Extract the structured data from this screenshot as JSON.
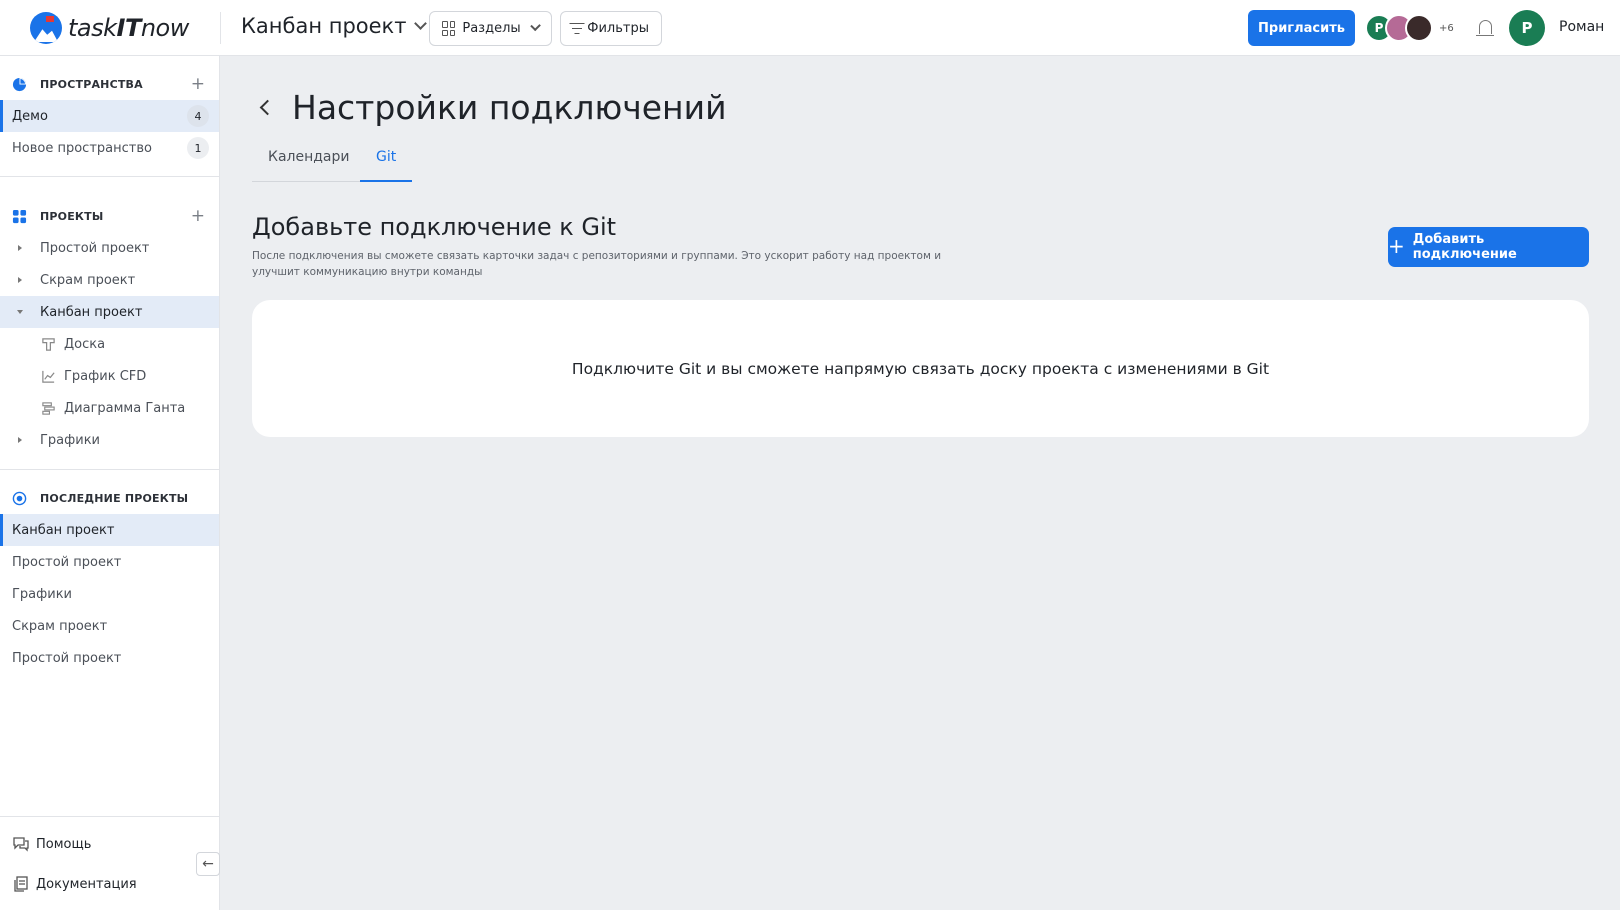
{
  "header": {
    "logo_text_1": "task",
    "logo_text_2": "IT",
    "logo_text_3": "now",
    "project_title": "Канбан проект",
    "sections_label": "Разделы",
    "filters_label": "Фильтры",
    "invite_label": "Пригласить",
    "avatars": [
      {
        "initial": "Р",
        "color": "#1a7d54"
      },
      {
        "initial": "",
        "color": "#b56a96"
      },
      {
        "initial": "",
        "color": "#3a2a2a"
      }
    ],
    "more_count": "+6",
    "user_initial": "Р",
    "user_name": "Роман"
  },
  "sidebar": {
    "spaces_title": "ПРОСТРАНСТВА",
    "spaces": [
      {
        "label": "Демо",
        "count": "4"
      },
      {
        "label": "Новое пространство",
        "count": "1"
      }
    ],
    "projects_title": "ПРОЕКТЫ",
    "projects": [
      {
        "label": "Простой проект"
      },
      {
        "label": "Скрам проект"
      },
      {
        "label": "Канбан проект"
      }
    ],
    "kanban_children": [
      {
        "label": "Доска"
      },
      {
        "label": "График CFD"
      },
      {
        "label": "Диаграмма Ганта"
      }
    ],
    "charts_label": "Графики",
    "recent_title": "ПОСЛЕДНИЕ ПРОЕКТЫ",
    "recent": [
      {
        "label": "Канбан проект"
      },
      {
        "label": "Простой проект"
      },
      {
        "label": "Графики"
      },
      {
        "label": "Скрам проект"
      },
      {
        "label": "Простой проект"
      }
    ],
    "help_label": "Помощь",
    "docs_label": "Документация"
  },
  "main": {
    "page_title": "Настройки подключений",
    "tabs": [
      {
        "label": "Календари"
      },
      {
        "label": "Git"
      }
    ],
    "heading": "Добавьте подключение к Git",
    "description": "После подключения вы сможете связать карточки задач с репозиториями и группами. Это ускорит работу над проектом и улучшит коммуникацию внутри команды",
    "add_button_label": "Добавить подключение",
    "empty_text": "Подключите Git и вы сможете напрямую связать доску проекта с изменениями в Git"
  },
  "colors": {
    "accent": "#1a73e8",
    "background": "#eceef1",
    "active_item": "#e3ebf7"
  }
}
